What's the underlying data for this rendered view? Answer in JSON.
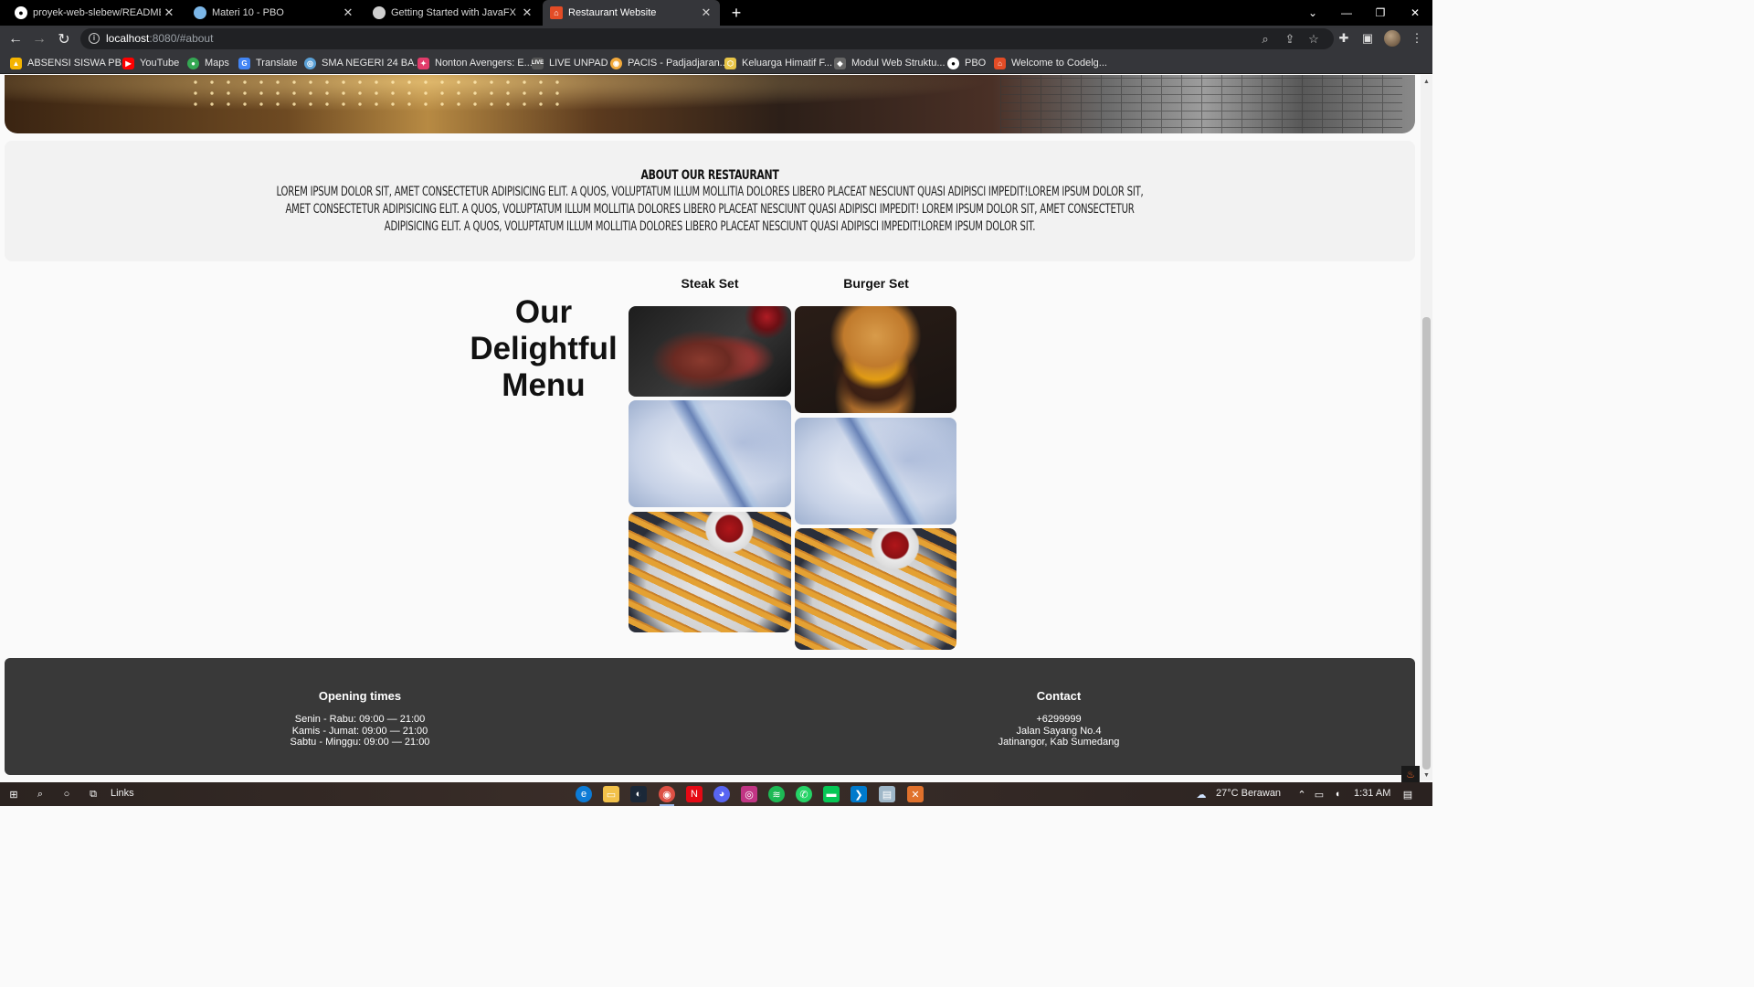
{
  "tabs": [
    {
      "title": "proyek-web-slebew/README.md",
      "icon": "github-icon",
      "color": "#ffffff"
    },
    {
      "title": "Materi 10 - PBO",
      "icon": "globe-icon",
      "color": "#7cb7e8"
    },
    {
      "title": "Getting Started with JavaFX",
      "icon": "globe-icon",
      "color": "#cfcfcf"
    },
    {
      "title": "Restaurant Website",
      "icon": "restaurant-icon",
      "color": "#e34c26"
    }
  ],
  "address": {
    "host": "localhost",
    "rest": ":8080/#about"
  },
  "bookmarks": [
    {
      "label": "ABSENSI SISWA PB...",
      "icon": "drive-icon",
      "color": "#f4b400"
    },
    {
      "label": "YouTube",
      "icon": "youtube-icon",
      "color": "#ff0000"
    },
    {
      "label": "Maps",
      "icon": "maps-icon",
      "color": "#34a853"
    },
    {
      "label": "Translate",
      "icon": "translate-icon",
      "color": "#4285f4"
    },
    {
      "label": "SMA NEGERI 24 BA...",
      "icon": "school-icon",
      "color": "#5aa0d6"
    },
    {
      "label": "Nonton Avengers: E...",
      "icon": "film-icon",
      "color": "#e23c6b"
    },
    {
      "label": "LIVE UNPAD",
      "icon": "live-icon",
      "color": "#cfcfcf"
    },
    {
      "label": "PACIS - Padjadjaran...",
      "icon": "pacis-icon",
      "color": "#f2a93b"
    },
    {
      "label": "Keluarga Himatif F...",
      "icon": "himatif-icon",
      "color": "#e8c547"
    },
    {
      "label": "Modul Web Struktu...",
      "icon": "module-icon",
      "color": "#dddddd"
    },
    {
      "label": "PBO",
      "icon": "github-icon",
      "color": "#ffffff"
    },
    {
      "label": "Welcome to Codelg...",
      "icon": "codelg-icon",
      "color": "#e34c26"
    }
  ],
  "about": {
    "title": "About our restaurant",
    "text": "Lorem ipsum dolor sit, amet consectetur adipisicing elit. A quos, voluptatum illum mollitia dolores libero placeat nesciunt quasi adipisci impedit!Lorem ipsum dolor sit, amet consectetur adipisicing elit. A quos, voluptatum illum mollitia dolores libero placeat nesciunt quasi adipisci impedit! Lorem ipsum dolor sit, amet consectetur adipisicing elit. A quos, voluptatum illum mollitia dolores libero placeat nesciunt quasi adipisci impedit!Lorem ipsum dolor sit."
  },
  "menu": {
    "heading": "Our Delightful Menu",
    "sets": [
      {
        "name": "Steak Set",
        "items": [
          "steak",
          "mineral water",
          "french fries"
        ]
      },
      {
        "name": "Burger Set",
        "items": [
          "burger",
          "mineral water",
          "french fries"
        ]
      }
    ]
  },
  "footer": {
    "opening": {
      "title": "Opening times",
      "lines": [
        "Senin - Rabu: 09:00 — 21:00",
        "Kamis - Jumat: 09:00 — 21:00",
        "Sabtu - Minggu: 09:00 — 21:00"
      ]
    },
    "contact": {
      "title": "Contact",
      "lines": [
        "+6299999",
        "Jalan Sayang No.4",
        "Jatinangor, Kab Sumedang"
      ]
    }
  },
  "taskbar": {
    "search_label": "Links",
    "weather": "27°C  Berawan",
    "time": "1:31 AM"
  }
}
